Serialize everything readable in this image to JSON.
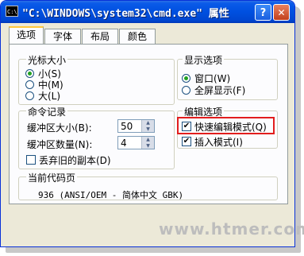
{
  "window": {
    "title": "\"C:\\WINDOWS\\system32\\cmd.exe\" 属性",
    "app_icon": "C:\\",
    "help_label": "?",
    "close_label": "✕"
  },
  "tabs": [
    {
      "label": "选项",
      "active": true
    },
    {
      "label": "字体",
      "active": false
    },
    {
      "label": "布局",
      "active": false
    },
    {
      "label": "颜色",
      "active": false
    }
  ],
  "cursor_size": {
    "legend": "光标大小",
    "options": [
      {
        "label": "小(S)",
        "checked": true
      },
      {
        "label": "中(M)",
        "checked": false
      },
      {
        "label": "大(L)",
        "checked": false
      }
    ]
  },
  "display_options": {
    "legend": "显示选项",
    "options": [
      {
        "label": "窗口(W)",
        "checked": true
      },
      {
        "label": "全屏显示(F)",
        "checked": false
      }
    ]
  },
  "command_history": {
    "legend": "命令记录",
    "buffer_size_label": "缓冲区大小(B):",
    "buffer_size_value": "50",
    "buffer_count_label": "缓冲区数量(N):",
    "buffer_count_value": "4",
    "discard_label": "丢弃旧的副本(D)",
    "discard_checked": false
  },
  "edit_options": {
    "legend": "编辑选项",
    "quick_edit_label": "快速编辑模式(Q)",
    "quick_edit_checked": true,
    "insert_mode_label": "插入模式(I)",
    "insert_mode_checked": true
  },
  "code_page": {
    "legend": "当前代码页",
    "value": "936   (ANSI/OEM - 简体中文 GBK)"
  },
  "watermark": "www.htmer.com",
  "colors": {
    "titlebar": "#0050e0",
    "dialog_bg": "#ece9d8",
    "highlight": "#e21d1d"
  }
}
